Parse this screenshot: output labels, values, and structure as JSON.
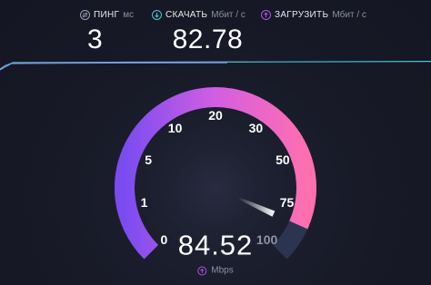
{
  "stats": {
    "ping": {
      "label": "ПИНГ",
      "unit": "мс",
      "value": "3",
      "icon": "ping-icon"
    },
    "download": {
      "label": "СКАЧАТЬ",
      "unit": "Мбит / с",
      "value": "82.78",
      "icon": "download-icon"
    },
    "upload": {
      "label": "ЗАГРУЗИТЬ",
      "unit": "Мбит / с",
      "icon": "upload-icon"
    }
  },
  "gauge": {
    "ticks": [
      "0",
      "1",
      "5",
      "10",
      "20",
      "30",
      "50",
      "75",
      "100"
    ],
    "reached_tick_count": 8,
    "current_value": 84.52,
    "current_value_text": "84.52",
    "unit": "Mbps",
    "unit_icon": "upload-icon"
  },
  "colors": {
    "background": "#161826",
    "gauge_start": "#7a4cf0",
    "gauge_mid": "#d35ee2",
    "gauge_end": "#ff6fb0",
    "gauge_track": "#2b3550",
    "download_line": "#49c4d9",
    "upload_line": "#b47be8",
    "upload_accent": "#b056e0"
  }
}
